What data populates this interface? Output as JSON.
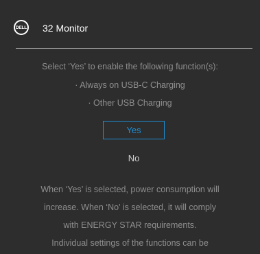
{
  "header": {
    "logo_text": "DELL",
    "title": "32 Monitor"
  },
  "dialog": {
    "prompt": "Select ‘Yes’ to enable the following function(s):",
    "functions": [
      "·  Always on USB-C Charging",
      "·  Other USB Charging"
    ],
    "yes_label": "Yes",
    "no_label": "No",
    "note_lines": [
      "When ‘Yes’ is selected, power consumption will",
      "increase. When ‘No’ is selected, it will comply",
      "with ENERGY STAR requirements.",
      "Individual settings of the functions can be"
    ]
  },
  "colors": {
    "background": "#2d2d2d",
    "accent": "#1f8fd6",
    "text_muted": "#8e8e8e",
    "text_primary": "#ffffff"
  }
}
